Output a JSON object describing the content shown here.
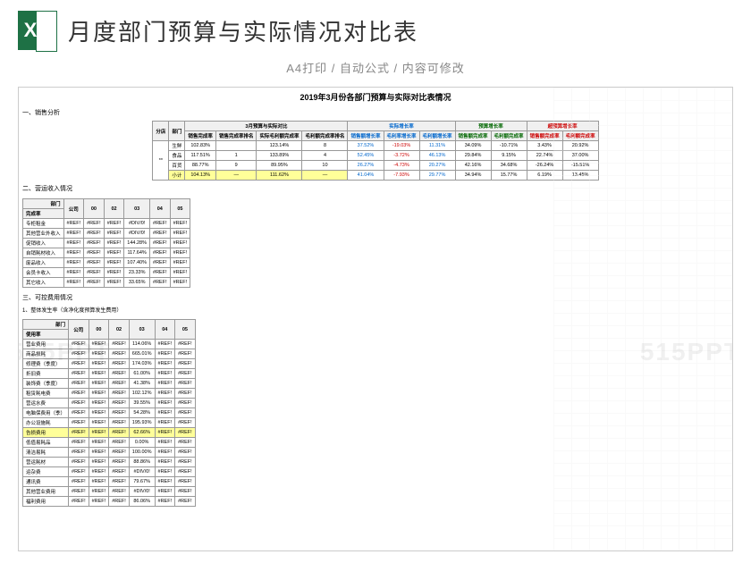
{
  "header": {
    "title": "月度部门预算与实际情况对比表",
    "subtitle": "A4打印 / 自动公式 / 内容可修改",
    "icon_letter": "X"
  },
  "watermark": "515PPT",
  "sheet": {
    "main_title": "2019年3月份各部门预算与实际对比表情况",
    "section1": "一、销售分析",
    "table1": {
      "h1": "分店",
      "h2": "部门",
      "h3": "3月预算与实际对比",
      "h3a": "销售完成率",
      "h3b": "销售完成率排名",
      "h3c": "实际毛利额完成率",
      "h3d": "毛利额完成率排名",
      "g2": "实际增长率",
      "g2a": "销售额增长率",
      "g2b": "毛利率增长率",
      "g2c": "毛利额增长率",
      "g3": "预算增长率",
      "g3a": "销售额完成率",
      "g3b": "毛利额完成率",
      "g4": "超预算增长率",
      "g4a": "销售额完成率",
      "g4b": "毛利额完成率",
      "store": "**",
      "rows": [
        {
          "dept": "生鲜",
          "a": "102.83%",
          "b": "",
          "c": "123.14%",
          "d": "8",
          "e": "37.52%",
          "f": "-19.03%",
          "g": "11.31%",
          "h": "34.09%",
          "i": "-10.71%",
          "j": "3.43%",
          "k": "20.92%"
        },
        {
          "dept": "食品",
          "a": "117.51%",
          "b": "1",
          "c": "133.89%",
          "d": "4",
          "e": "52.45%",
          "f": "-3.72%",
          "g": "46.13%",
          "h": "29.84%",
          "i": "9.15%",
          "j": "22.74%",
          "k": "37.00%"
        },
        {
          "dept": "百货",
          "a": "88.77%",
          "b": "9",
          "c": "89.95%",
          "d": "10",
          "e": "26.27%",
          "f": "-4.73%",
          "g": "20.27%",
          "h": "42.16%",
          "i": "34.68%",
          "j": "-26.24%",
          "k": "-15.51%"
        },
        {
          "dept": "小计",
          "a": "104.13%",
          "b": "—",
          "c": "111.62%",
          "d": "—",
          "e": "41.04%",
          "f": "-7.93%",
          "g": "29.77%",
          "h": "34.94%",
          "i": "15.77%",
          "j": "6.19%",
          "k": "13.45%"
        }
      ]
    },
    "section2": "二、营运收入情况",
    "table2": {
      "h_dept": "部门",
      "h_rate": "完成率",
      "cols": [
        "公司",
        "00",
        "02",
        "03",
        "04",
        "05"
      ],
      "rows": [
        {
          "label": "专柜租金",
          "v": [
            "#REF!",
            "#REF!",
            "#REF!",
            "#DIV/0!",
            "#REF!",
            "#REF!"
          ]
        },
        {
          "label": "其他营业外收入",
          "v": [
            "#REF!",
            "#REF!",
            "#REF!",
            "#DIV/0!",
            "#REF!",
            "#REF!"
          ]
        },
        {
          "label": "促销收入",
          "v": [
            "#REF!",
            "#REF!",
            "#REF!",
            "144.28%",
            "#REF!",
            "#REF!"
          ]
        },
        {
          "label": "自销耗材收入",
          "v": [
            "#REF!",
            "#REF!",
            "#REF!",
            "117.64%",
            "#REF!",
            "#REF!"
          ]
        },
        {
          "label": "废品收入",
          "v": [
            "#REF!",
            "#REF!",
            "#REF!",
            "107.40%",
            "#REF!",
            "#REF!"
          ]
        },
        {
          "label": "会员卡收入",
          "v": [
            "#REF!",
            "#REF!",
            "#REF!",
            "23.33%",
            "#REF!",
            "#REF!"
          ]
        },
        {
          "label": "其它收入",
          "v": [
            "#REF!",
            "#REF!",
            "#REF!",
            "33.65%",
            "#REF!",
            "#REF!"
          ]
        }
      ]
    },
    "section3": "三、可控费用情况",
    "section3_note": "1、整体发生率（含净化度预算发生费用）",
    "table3": {
      "h_dept": "部门",
      "h_rate": "使用率",
      "cols": [
        "公司",
        "00",
        "02",
        "03",
        "04",
        "05"
      ],
      "rows": [
        {
          "label": "营业费用",
          "v": [
            "#REF!",
            "#REF!",
            "#REF!",
            "114.06%",
            "#REF!",
            "#REF!"
          ]
        },
        {
          "label": "商品损耗",
          "v": [
            "#REF!",
            "#REF!",
            "#REF!",
            "665.01%",
            "#REF!",
            "#REF!"
          ]
        },
        {
          "label": "修理费（季度）",
          "v": [
            "#REF!",
            "#REF!",
            "#REF!",
            "174.03%",
            "#REF!",
            "#REF!"
          ]
        },
        {
          "label": "折旧费",
          "v": [
            "#REF!",
            "#REF!",
            "#REF!",
            "61.00%",
            "#REF!",
            "#REF!"
          ]
        },
        {
          "label": "装饰费（季度）",
          "v": [
            "#REF!",
            "#REF!",
            "#REF!",
            "41.38%",
            "#REF!",
            "#REF!"
          ]
        },
        {
          "label": "租赁耗电费",
          "v": [
            "#REF!",
            "#REF!",
            "#REF!",
            "102.12%",
            "#REF!",
            "#REF!"
          ]
        },
        {
          "label": "营运水费",
          "v": [
            "#REF!",
            "#REF!",
            "#REF!",
            "39.55%",
            "#REF!",
            "#REF!"
          ]
        },
        {
          "label": "电脑保费用（季）",
          "v": [
            "#REF!",
            "#REF!",
            "#REF!",
            "54.28%",
            "#REF!",
            "#REF!"
          ]
        },
        {
          "label": "办公设施耗",
          "v": [
            "#REF!",
            "#REF!",
            "#REF!",
            "195.93%",
            "#REF!",
            "#REF!"
          ]
        },
        {
          "label": "告损费用",
          "hl": true,
          "v": [
            "#REF!",
            "#REF!",
            "#REF!",
            "62.66%",
            "#REF!",
            "#REF!"
          ]
        },
        {
          "label": "低值易耗品",
          "v": [
            "#REF!",
            "#REF!",
            "#REF!",
            "0.00%",
            "#REF!",
            "#REF!"
          ]
        },
        {
          "label": "清洁易耗",
          "v": [
            "#REF!",
            "#REF!",
            "#REF!",
            "100.00%",
            "#REF!",
            "#REF!"
          ]
        },
        {
          "label": "营运耗材",
          "v": [
            "#REF!",
            "#REF!",
            "#REF!",
            "88.86%",
            "#REF!",
            "#REF!"
          ]
        },
        {
          "label": "运杂费",
          "v": [
            "#REF!",
            "#REF!",
            "#REF!",
            "#DIV/0!",
            "#REF!",
            "#REF!"
          ]
        },
        {
          "label": "通讯费",
          "v": [
            "#REF!",
            "#REF!",
            "#REF!",
            "79.67%",
            "#REF!",
            "#REF!"
          ]
        },
        {
          "label": "其他营业费用",
          "v": [
            "#REF!",
            "#REF!",
            "#REF!",
            "#DIV/0!",
            "#REF!",
            "#REF!"
          ]
        },
        {
          "label": "福利费用",
          "v": [
            "#REF!",
            "#REF!",
            "#REF!",
            "86.06%",
            "#REF!",
            "#REF!"
          ]
        }
      ]
    }
  }
}
